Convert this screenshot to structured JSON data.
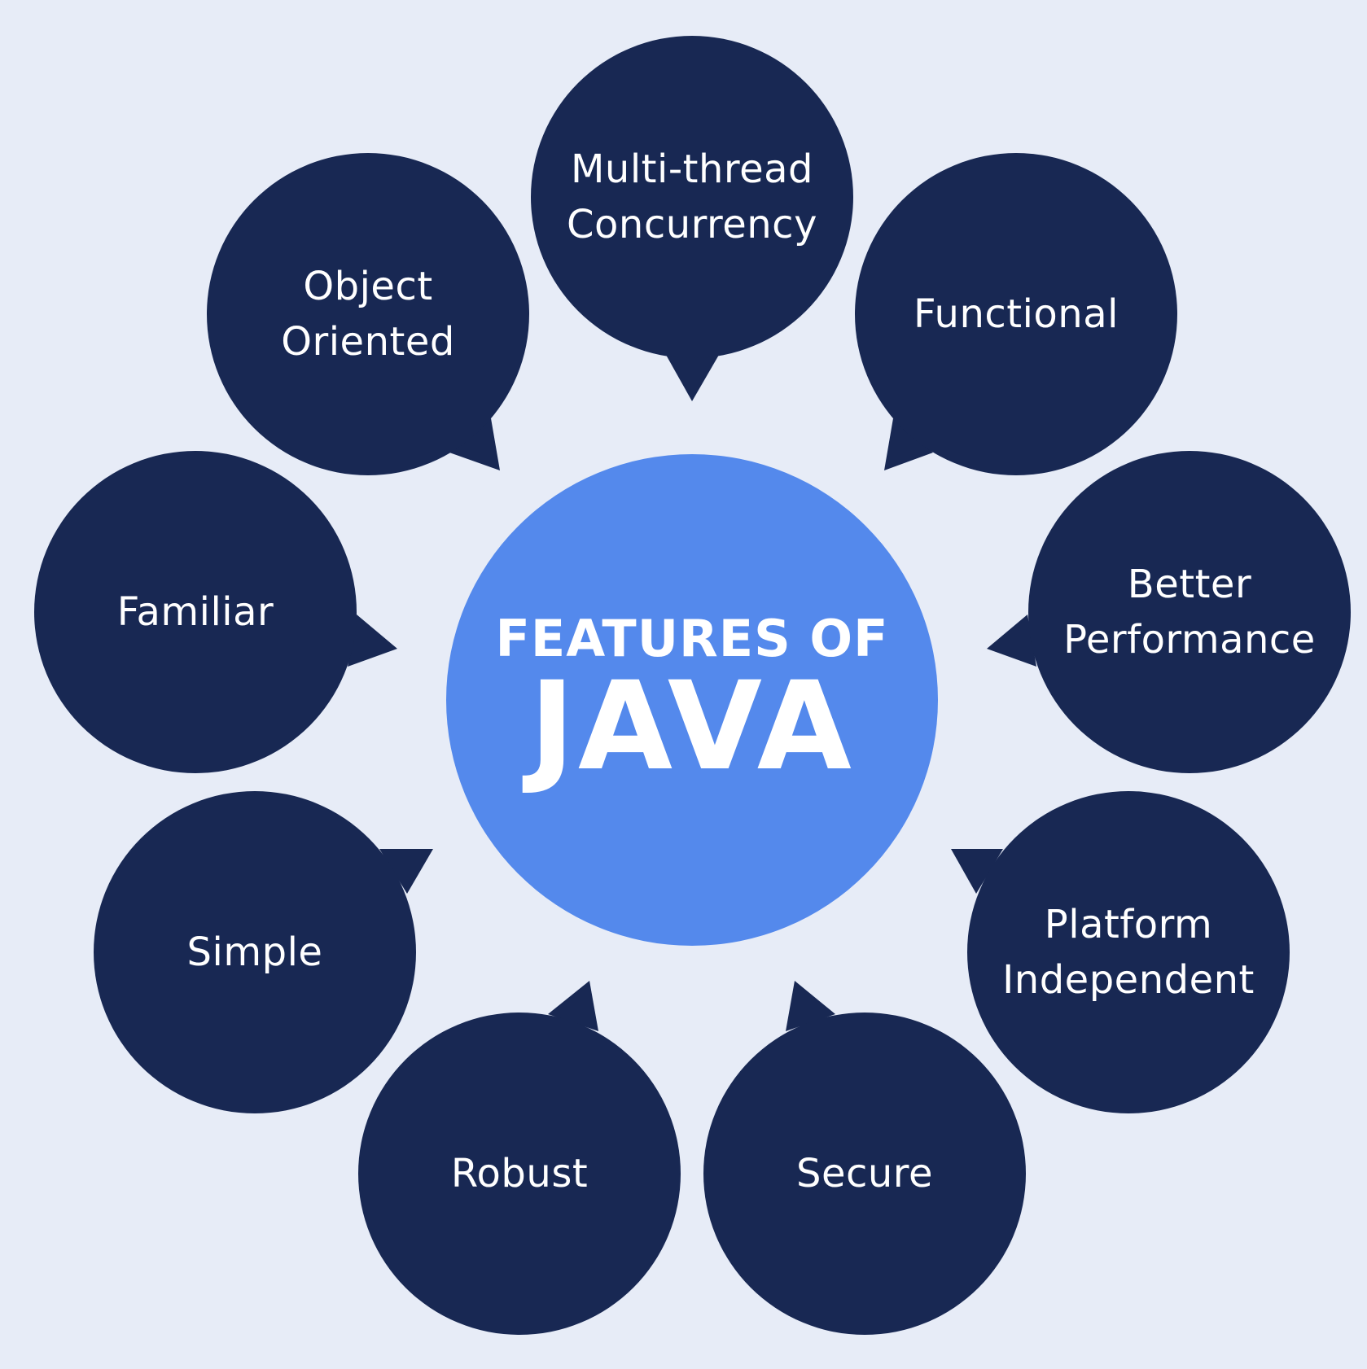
{
  "colors": {
    "background": "#e7ecf7",
    "bubble": "#182853",
    "center": "#5489ec",
    "text": "#ffffff"
  },
  "center": {
    "line1": "FEATURES OF",
    "line2": "JAVA"
  },
  "features": [
    {
      "id": "multi-thread-concurrency",
      "lines": [
        "Multi-thread",
        "Concurrency"
      ]
    },
    {
      "id": "functional",
      "lines": [
        "Functional"
      ]
    },
    {
      "id": "better-performance",
      "lines": [
        "Better",
        "Performance"
      ]
    },
    {
      "id": "platform-independent",
      "lines": [
        "Platform",
        "Independent"
      ]
    },
    {
      "id": "secure",
      "lines": [
        "Secure"
      ]
    },
    {
      "id": "robust",
      "lines": [
        "Robust"
      ]
    },
    {
      "id": "simple",
      "lines": [
        "Simple"
      ]
    },
    {
      "id": "familiar",
      "lines": [
        "Familiar"
      ]
    },
    {
      "id": "object-oriented",
      "lines": [
        "Object",
        "Oriented"
      ]
    }
  ]
}
